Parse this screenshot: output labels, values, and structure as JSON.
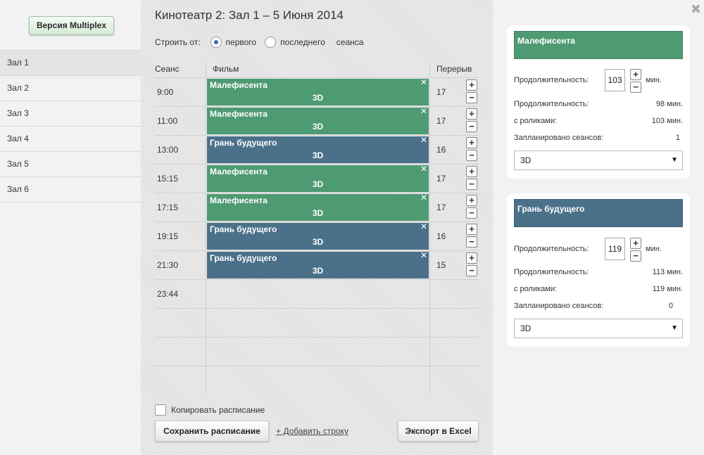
{
  "left": {
    "version_button": "Версия Multiplex",
    "halls": [
      "Зал 1",
      "Зал 2",
      "Зал 3",
      "Зал 4",
      "Зал 5",
      "Зал 6"
    ]
  },
  "main": {
    "title": "Кинотеатр 2: Зал 1 – 5 Июня 2014",
    "build_label": "Строить от:",
    "build_first": "первого",
    "build_last": "последнего",
    "build_suffix": "сеанса",
    "col_session": "Сеанс",
    "col_film": "Фильм",
    "col_break": "Перерыв",
    "rows": [
      {
        "time": "9:00",
        "film": "Малефисента",
        "format": "3D",
        "break": "17",
        "color": "green"
      },
      {
        "time": "11:00",
        "film": "Малефисента",
        "format": "3D",
        "break": "17",
        "color": "green"
      },
      {
        "time": "13:00",
        "film": "Грань будущего",
        "format": "3D",
        "break": "16",
        "color": "blue"
      },
      {
        "time": "15:15",
        "film": "Малефисента",
        "format": "3D",
        "break": "17",
        "color": "green"
      },
      {
        "time": "17:15",
        "film": "Малефисента",
        "format": "3D",
        "break": "17",
        "color": "green"
      },
      {
        "time": "19:15",
        "film": "Грань будущего",
        "format": "3D",
        "break": "16",
        "color": "blue"
      },
      {
        "time": "21:30",
        "film": "Грань будущего",
        "format": "3D",
        "break": "15",
        "color": "blue"
      },
      {
        "time": "23:44",
        "film": "",
        "format": "",
        "break": "",
        "color": ""
      },
      {
        "time": "",
        "film": "",
        "format": "",
        "break": "",
        "color": ""
      },
      {
        "time": "",
        "film": "",
        "format": "",
        "break": "",
        "color": ""
      },
      {
        "time": "",
        "film": "",
        "format": "",
        "break": "",
        "color": ""
      }
    ],
    "copy_schedule": "Копировать расписание",
    "save_button": "Сохранить расписание",
    "add_row": "+ Добавить строку",
    "export_button": "Экспорт в Excel"
  },
  "right": {
    "cards": [
      {
        "title": "Малефисента",
        "color": "green",
        "duration_label": "Продолжительность:",
        "duration_input": "103",
        "unit": "мин.",
        "length_label": "Продолжительность:",
        "length_value": "98 мин.",
        "with_ads_label": "с роликами:",
        "with_ads_value": "103 мин.",
        "planned_label": "Запланировано сеансов:",
        "planned_value": "1",
        "format": "3D"
      },
      {
        "title": "Грань будущего",
        "color": "blue",
        "duration_label": "Продолжительность:",
        "duration_input": "119",
        "unit": "мин.",
        "length_label": "Продолжительность:",
        "length_value": "113 мин.",
        "with_ads_label": "с роликами:",
        "with_ads_value": "119 мин.",
        "planned_label": "Запланировано сеансов:",
        "planned_value": "0",
        "format": "3D"
      }
    ]
  },
  "colors": {
    "green": "#4e9a72",
    "blue": "#4b718a"
  },
  "icons": {
    "close": "close-icon",
    "plus": "plus-icon",
    "minus": "minus-icon",
    "remove": "remove-session-icon",
    "dropdown": "chevron-down-icon"
  }
}
